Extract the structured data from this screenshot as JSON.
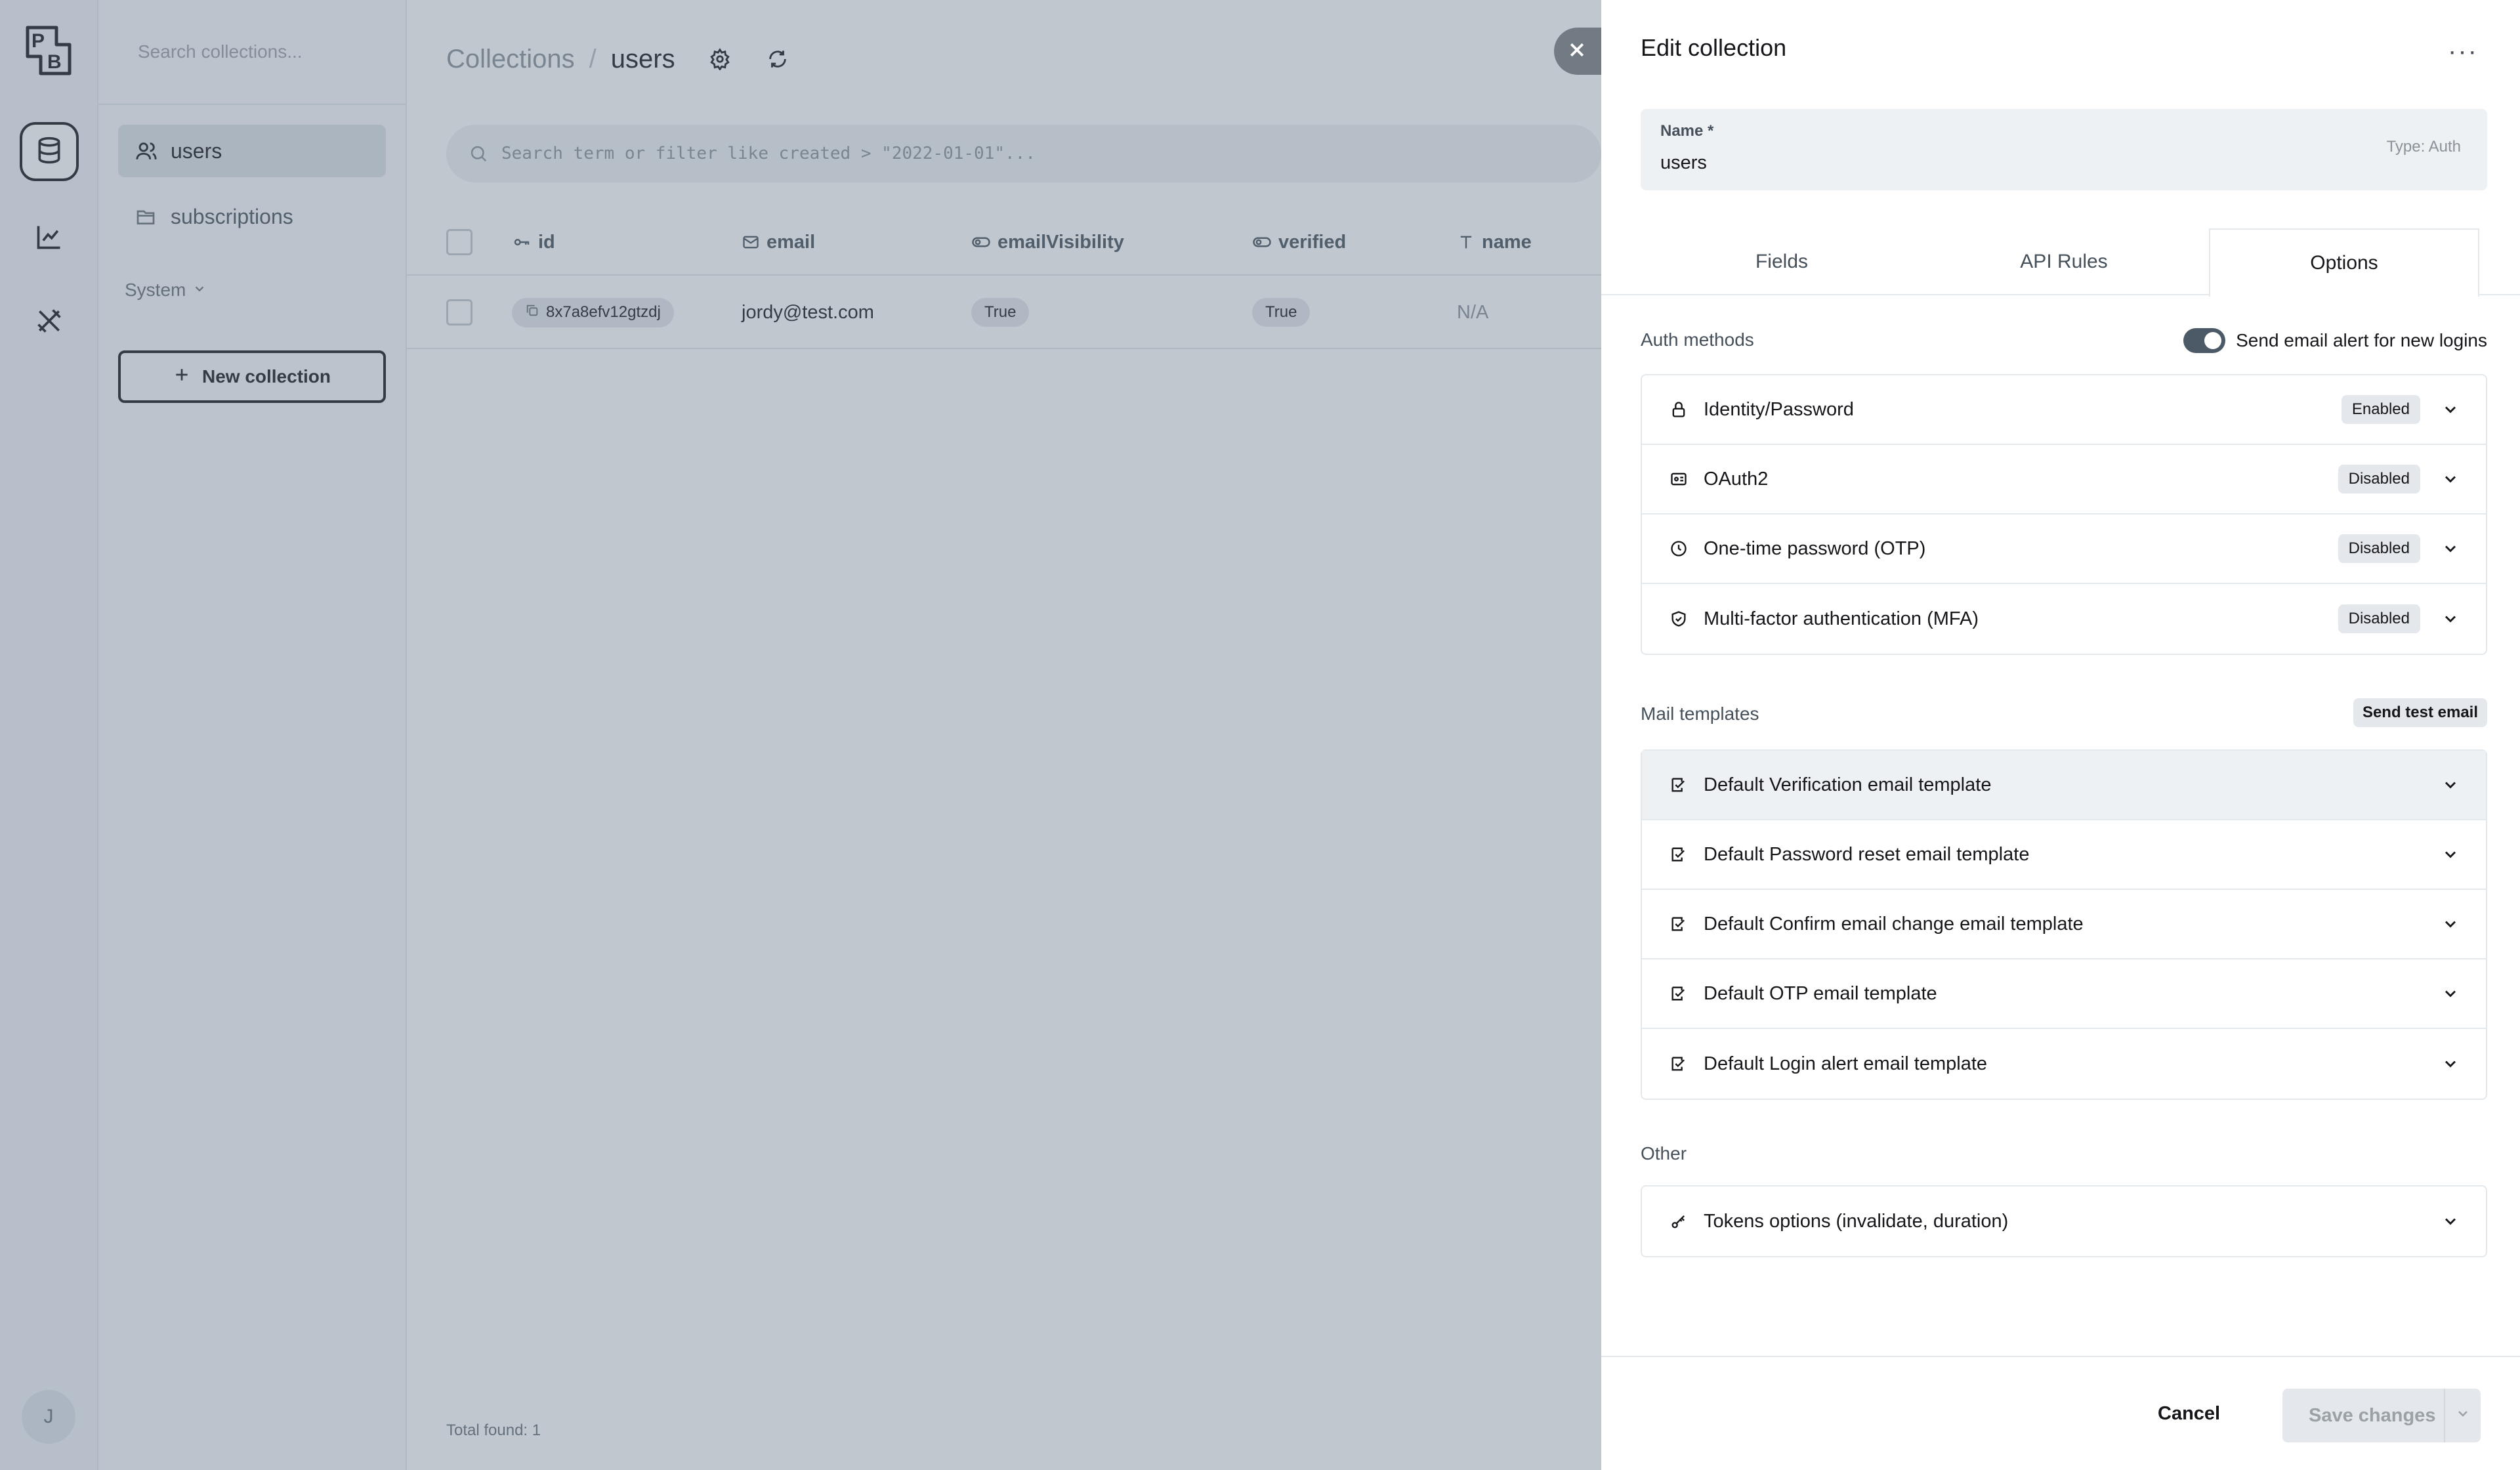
{
  "nav": {
    "logo_p": "P",
    "logo_b": "B",
    "avatar_initial": "J"
  },
  "sidebar": {
    "search_placeholder": "Search collections...",
    "items": [
      {
        "label": "users",
        "icon": "users-icon"
      },
      {
        "label": "subscriptions",
        "icon": "folder-icon"
      }
    ],
    "system_label": "System",
    "new_collection": "New collection"
  },
  "main": {
    "breadcrumb_root": "Collections",
    "breadcrumb_sep": "/",
    "breadcrumb_current": "users",
    "search_placeholder": "Search term or filter like created > \"2022-01-01\"...",
    "columns": [
      "id",
      "email",
      "emailVisibility",
      "verified",
      "name"
    ],
    "rows": [
      {
        "id": "8x7a8efv12gtzdj",
        "email": "jordy@test.com",
        "emailVisibility": "True",
        "verified": "True",
        "name": "N/A"
      }
    ],
    "total_label": "Total found:",
    "total_value": "1"
  },
  "panel": {
    "title": "Edit collection",
    "more": "···",
    "name_label": "Name *",
    "name_value": "users",
    "type_label": "Type: Auth",
    "tabs": [
      "Fields",
      "API Rules",
      "Options"
    ],
    "active_tab": "Options",
    "auth_methods_title": "Auth methods",
    "send_alert_label": "Send email alert for new logins",
    "send_alert_on": true,
    "auth_methods": [
      {
        "label": "Identity/Password",
        "status": "Enabled",
        "icon": "lock-icon"
      },
      {
        "label": "OAuth2",
        "status": "Disabled",
        "icon": "id-card-icon"
      },
      {
        "label": "One-time password (OTP)",
        "status": "Disabled",
        "icon": "clock-icon"
      },
      {
        "label": "Multi-factor authentication (MFA)",
        "status": "Disabled",
        "icon": "shield-check-icon"
      }
    ],
    "mail_templates_title": "Mail templates",
    "send_test_email": "Send test email",
    "mail_templates": [
      "Default Verification email template",
      "Default Password reset email template",
      "Default Confirm email change email template",
      "Default OTP email template",
      "Default Login alert email template"
    ],
    "other_title": "Other",
    "other_items": [
      "Tokens options (invalidate, duration)"
    ],
    "cancel_label": "Cancel",
    "save_label": "Save changes"
  },
  "colors": {
    "accent": "#16161a",
    "muted": "#8a9299",
    "surface": "#eef1f4",
    "overlay": "rgba(98,114,136,0.40)"
  }
}
